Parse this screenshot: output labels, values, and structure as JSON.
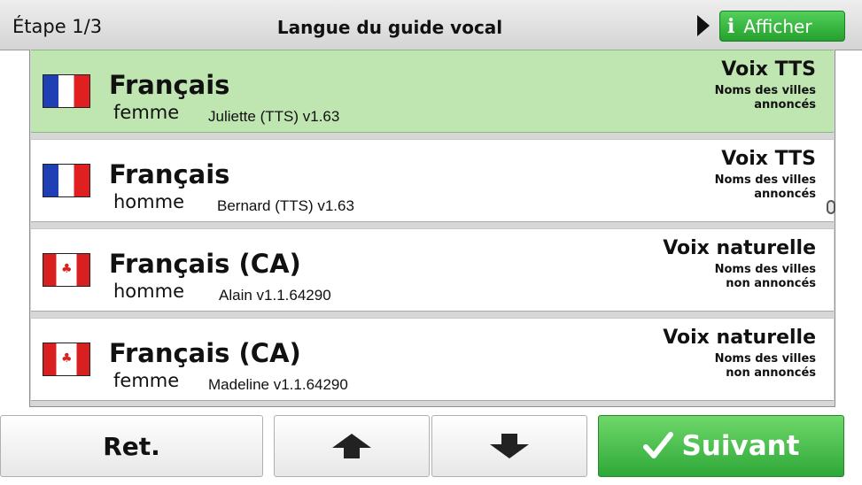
{
  "header": {
    "step": "Étape 1/3",
    "title": "Langue du guide vocal",
    "show_button": "Afficher",
    "show_icon": "i"
  },
  "voices": [
    {
      "language": "Français",
      "gender": "femme",
      "voice": "Juliette (TTS) v1.63",
      "type": "Voix TTS",
      "note_line1": "Noms des villes",
      "note_line2": "annoncés",
      "flag": "france-flag-icon",
      "selected": true
    },
    {
      "language": "Français",
      "gender": "homme",
      "voice": "Bernard (TTS) v1.63",
      "type": "Voix TTS",
      "note_line1": "Noms des villes",
      "note_line2": "annoncés",
      "flag": "france-flag-icon",
      "selected": false
    },
    {
      "language": "Français (CA)",
      "gender": "homme",
      "voice": "Alain v1.1.64290",
      "type": "Voix naturelle",
      "note_line1": "Noms des villes",
      "note_line2": "non annoncés",
      "flag": "canada-flag-icon",
      "selected": false
    },
    {
      "language": "Français (CA)",
      "gender": "femme",
      "voice": "Madeline v1.1.64290",
      "type": "Voix naturelle",
      "note_line1": "Noms des villes",
      "note_line2": "non annoncés",
      "flag": "canada-flag-icon",
      "selected": false
    }
  ],
  "footer": {
    "back": "Ret.",
    "next": "Suivant",
    "up_icon": "arrow-up-icon",
    "down_icon": "arrow-down-icon"
  },
  "colors": {
    "selected_row": "#bfe6b0",
    "accent_green": "#2ea838",
    "header_bg": "#d4d4d4"
  }
}
